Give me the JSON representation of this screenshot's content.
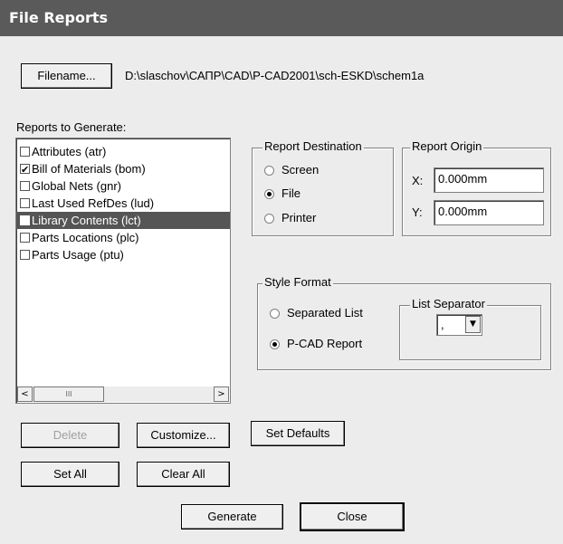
{
  "window": {
    "title": "File Reports"
  },
  "filename": {
    "button_label": "Filename...",
    "path": "D:\\slaschov\\САПР\\CAD\\P-CAD2001\\sch-ESKD\\schem1a"
  },
  "reports": {
    "label": "Reports to Generate:",
    "items": [
      {
        "label": "Attributes  (atr)",
        "checked": false
      },
      {
        "label": "Bill of Materials  (bom)",
        "checked": true
      },
      {
        "label": "Global Nets  (gnr)",
        "checked": false
      },
      {
        "label": "Last Used RefDes  (lud)",
        "checked": false
      },
      {
        "label": "Library Contents  (lct)",
        "checked": false,
        "selected": true
      },
      {
        "label": "Parts Locations  (plc)",
        "checked": false
      },
      {
        "label": "Parts Usage  (ptu)",
        "checked": false
      }
    ],
    "scroll_left_icon": "<",
    "scroll_right_icon": ">",
    "thumb_grip": "III"
  },
  "destination": {
    "label": "Report Destination",
    "options": [
      "Screen",
      "File",
      "Printer"
    ],
    "selected": "File"
  },
  "origin": {
    "label": "Report Origin",
    "x_label": "X:",
    "x_value": "0.000mm",
    "y_label": "Y:",
    "y_value": "0.000mm"
  },
  "style": {
    "label": "Style Format",
    "options": [
      "Separated List",
      "P-CAD Report"
    ],
    "selected": "P-CAD Report",
    "separator_label": "List Separator",
    "separator_value": ",",
    "dropdown_icon": "▼"
  },
  "buttons": {
    "delete": "Delete",
    "customize": "Customize...",
    "set_defaults": "Set Defaults",
    "set_all": "Set All",
    "clear_all": "Clear All",
    "generate": "Generate",
    "close": "Close"
  }
}
